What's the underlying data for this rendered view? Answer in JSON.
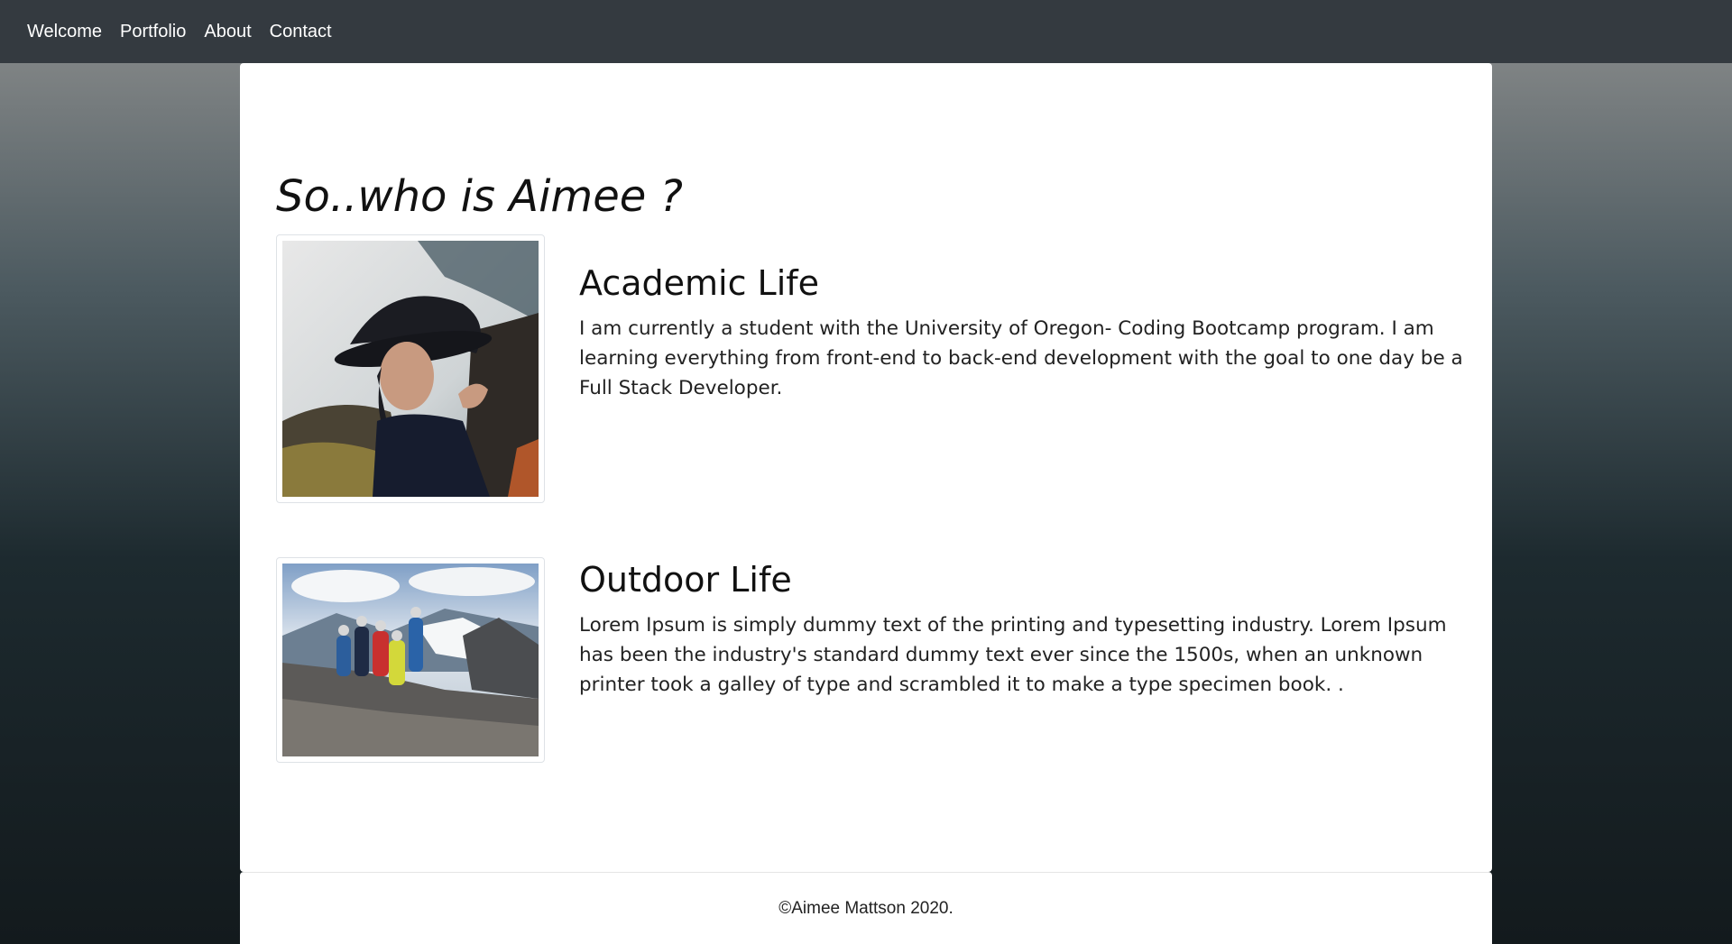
{
  "nav": {
    "items": [
      {
        "label": "Welcome"
      },
      {
        "label": "Portfolio"
      },
      {
        "label": "About"
      },
      {
        "label": "Contact"
      }
    ]
  },
  "main": {
    "title": "So..who is Aimee ?",
    "sections": [
      {
        "heading": "Academic Life",
        "body": "I am currently a student with the University of Oregon- Coding Bootcamp program. I am learning everything from front-end to back-end development with the goal to one day be a Full Stack Developer.",
        "image": "portrait-photo"
      },
      {
        "heading": "Outdoor Life",
        "body": "Lorem Ipsum is simply dummy text of the printing and typesetting industry. Lorem Ipsum has been the industry's standard dummy text ever since the 1500s, when an unknown printer took a galley of type and scrambled it to make a type specimen book. .",
        "image": "climbing-group-photo"
      }
    ]
  },
  "footer": {
    "text": "©Aimee Mattson 2020."
  },
  "colors": {
    "navbar": "#343a40",
    "card": "#ffffff",
    "background_top": "#7f8384",
    "background_bottom": "#131a1d"
  }
}
